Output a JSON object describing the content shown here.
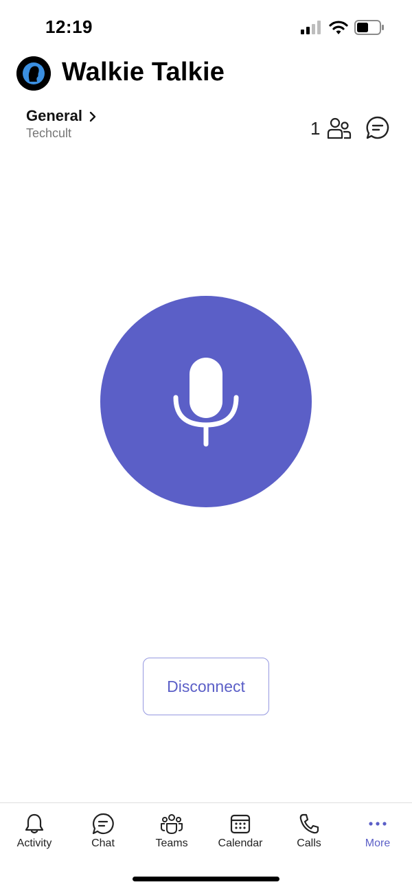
{
  "status_bar": {
    "time": "12:19"
  },
  "header": {
    "title": "Walkie Talkie",
    "avatar_icon": "person-silhouette-icon"
  },
  "channel": {
    "name": "General",
    "team": "Techcult",
    "participants": "1"
  },
  "mic": {
    "color": "#5B5FC7",
    "icon": "microphone-icon"
  },
  "actions": {
    "disconnect_label": "Disconnect"
  },
  "tabs": [
    {
      "label": "Activity",
      "icon": "bell-icon",
      "active": false
    },
    {
      "label": "Chat",
      "icon": "chat-icon",
      "active": false
    },
    {
      "label": "Teams",
      "icon": "teams-icon",
      "active": false
    },
    {
      "label": "Calendar",
      "icon": "calendar-icon",
      "active": false
    },
    {
      "label": "Calls",
      "icon": "phone-icon",
      "active": false
    },
    {
      "label": "More",
      "icon": "more-dots-icon",
      "active": true
    }
  ],
  "colors": {
    "accent": "#5B5FC7",
    "text_primary": "#111111",
    "text_secondary": "#757575"
  }
}
